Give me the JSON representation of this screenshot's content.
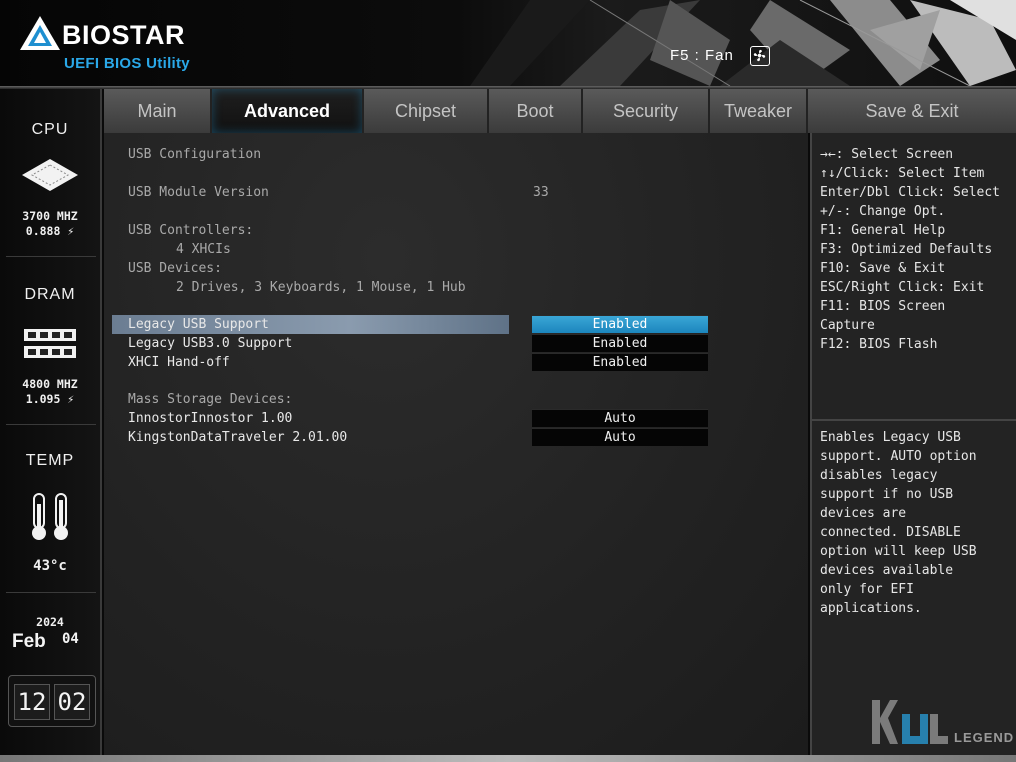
{
  "header": {
    "brand": "BIOSTAR",
    "subtitle": "UEFI BIOS Utility",
    "fan_hint": "F5 : Fan"
  },
  "sidebar": {
    "cpu": {
      "title": "CPU",
      "freq": "3700 MHZ",
      "volt": "0.888 ⚡"
    },
    "dram": {
      "title": "DRAM",
      "freq": "4800 MHZ",
      "volt": "1.095 ⚡"
    },
    "temp": {
      "title": "TEMP",
      "value": "43°c"
    },
    "date": {
      "year": "2024",
      "month": "Feb",
      "day": "04"
    },
    "time": {
      "hour": "12",
      "minute": "02"
    }
  },
  "tabs": [
    {
      "label": "Main"
    },
    {
      "label": "Advanced",
      "active": true
    },
    {
      "label": "Chipset"
    },
    {
      "label": "Boot"
    },
    {
      "label": "Security"
    },
    {
      "label": "Tweaker"
    },
    {
      "label": "Save & Exit"
    }
  ],
  "main": {
    "section_title": "USB Configuration",
    "module_version_label": "USB Module Version",
    "module_version_value": "33",
    "controllers_label": "USB Controllers:",
    "controllers_value": "4 XHCIs",
    "devices_label": "USB Devices:",
    "devices_value": "2 Drives, 3 Keyboards, 1 Mouse, 1 Hub",
    "settings": [
      {
        "label": "Legacy USB Support",
        "value": "Enabled"
      },
      {
        "label": "Legacy USB3.0 Support",
        "value": "Enabled"
      },
      {
        "label": "XHCI Hand-off",
        "value": "Enabled"
      }
    ],
    "mass_storage_label": "Mass Storage Devices:",
    "mass_storage": [
      {
        "label": "InnostorInnostor 1.00",
        "value": "Auto"
      },
      {
        "label": "KingstonDataTraveler 2.01.00",
        "value": "Auto"
      }
    ]
  },
  "help_keys": [
    "→←: Select Screen",
    "↑↓/Click: Select Item",
    "Enter/Dbl Click: Select",
    "+/-: Change Opt.",
    "F1: General Help",
    "F3: Optimized Defaults",
    "F10: Save & Exit",
    "ESC/Right Click: Exit",
    "F11: BIOS Screen",
    "Capture",
    "F12: BIOS Flash"
  ],
  "help_desc": [
    "Enables Legacy USB",
    "support. AUTO option",
    "disables legacy",
    "support if no USB",
    "devices are",
    "connected. DISABLE",
    "option will keep USB",
    "devices available",
    "only for EFI",
    "applications."
  ],
  "watermark": {
    "text": "LEGEND"
  },
  "colors": {
    "accent": "#2aa8e8",
    "selection_bar": "#8a9bae",
    "option_selected": "#2a96cb"
  }
}
